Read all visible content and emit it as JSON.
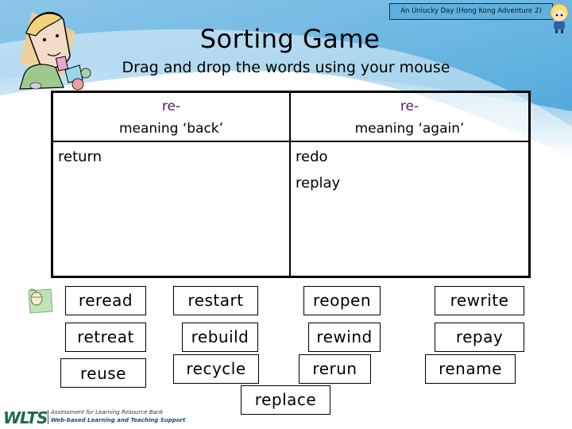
{
  "header": {
    "lesson_title": "An Unlucky Day (Hong Kong Adventure 2)",
    "page_title": "Sorting Game",
    "instruction": "Drag and drop the words using your mouse"
  },
  "colors": {
    "prefix": "#5a1a52",
    "background_top": "#5fb0de",
    "logo_green": "#1d6b4e"
  },
  "table": {
    "columns": [
      {
        "prefix": "re-",
        "meaning": "meaning ‘back’",
        "words": [
          "return"
        ]
      },
      {
        "prefix": "re-",
        "meaning": "meaning ‘again’",
        "words": [
          "redo",
          "replay"
        ]
      }
    ]
  },
  "word_bank": [
    "reread",
    "restart",
    "reopen",
    "rewrite",
    "retreat",
    "rebuild",
    "rewind",
    "repay",
    "reuse",
    "recycle",
    "rerun",
    "rename",
    "replace"
  ],
  "icons": {
    "mouse": "mouse-icon",
    "kid": "kid-illustration",
    "character": "character-icon"
  },
  "footer": {
    "logo_text": "WLTS",
    "line1": "Assessment for Learning Resource Bank",
    "line2": "Web-based Learning and Teaching Support"
  }
}
